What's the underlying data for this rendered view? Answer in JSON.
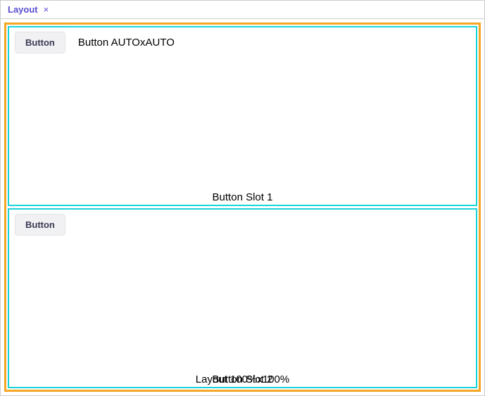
{
  "tab": {
    "title": "Layout",
    "close_glyph": "×"
  },
  "layout": {
    "root_label": "Layout 100%x100%",
    "slots": [
      {
        "label": "Button Slot 1",
        "button_label": "Button",
        "button_caption": "Button AUTOxAUTO"
      },
      {
        "label": "Button Slot 2",
        "button_label": "Button",
        "button_caption": ""
      }
    ]
  }
}
